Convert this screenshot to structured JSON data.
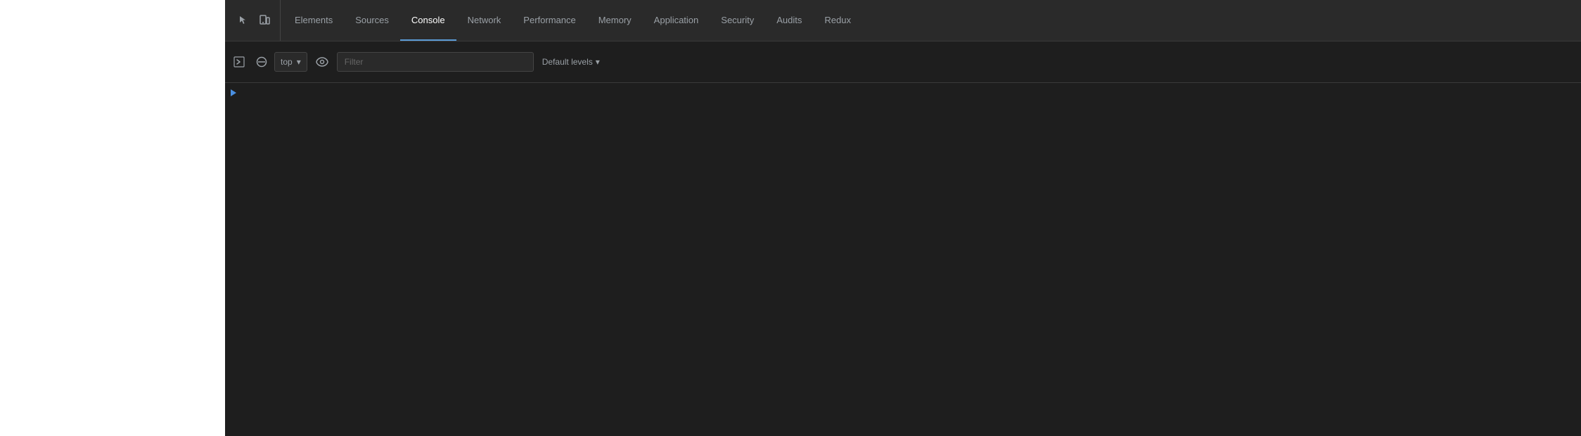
{
  "whitepanel": {
    "visible": true
  },
  "devtools": {
    "tabs": [
      {
        "id": "elements",
        "label": "Elements",
        "active": false
      },
      {
        "id": "sources",
        "label": "Sources",
        "active": false
      },
      {
        "id": "console",
        "label": "Console",
        "active": true
      },
      {
        "id": "network",
        "label": "Network",
        "active": false
      },
      {
        "id": "performance",
        "label": "Performance",
        "active": false
      },
      {
        "id": "memory",
        "label": "Memory",
        "active": false
      },
      {
        "id": "application",
        "label": "Application",
        "active": false
      },
      {
        "id": "security",
        "label": "Security",
        "active": false
      },
      {
        "id": "audits",
        "label": "Audits",
        "active": false
      },
      {
        "id": "redux",
        "label": "Redux",
        "active": false
      }
    ],
    "toolbar": {
      "top_selector_value": "top",
      "top_selector_arrow": "▾",
      "filter_placeholder": "Filter",
      "levels_label": "Default levels",
      "levels_arrow": "▾"
    },
    "console_prompt": ">"
  },
  "icons": {
    "cursor": "cursor-icon",
    "inspect": "inspect-icon",
    "execute": "execute-icon",
    "clear": "clear-icon",
    "eye": "eye-icon",
    "chevron_down": "▾",
    "chevron_right": "chevron-right-icon"
  }
}
